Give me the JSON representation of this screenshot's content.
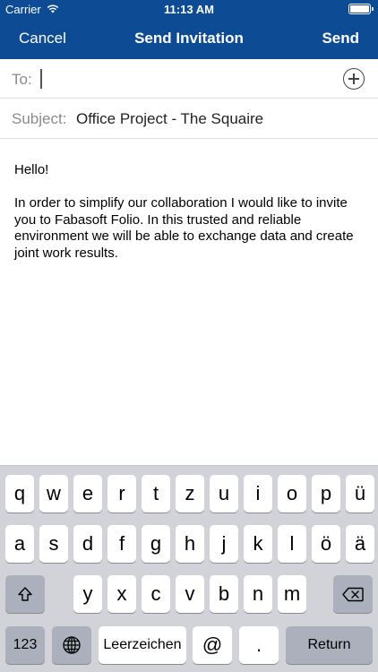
{
  "status": {
    "carrier": "Carrier",
    "time": "11:13 AM"
  },
  "nav": {
    "cancel": "Cancel",
    "title": "Send Invitation",
    "send": "Send"
  },
  "fields": {
    "to_label": "To:",
    "to_value": "",
    "subject_label": "Subject:",
    "subject_value": "Office Project - The Squaire"
  },
  "message": {
    "greeting": "Hello!",
    "text": "In order to simplify our collaboration I would like to invite you to Fabasoft Folio. In this trusted and reliable environment we will be able to exchange data and create joint work results."
  },
  "keyboard": {
    "row1": [
      "q",
      "w",
      "e",
      "r",
      "t",
      "z",
      "u",
      "i",
      "o",
      "p",
      "ü"
    ],
    "row2": [
      "a",
      "s",
      "d",
      "f",
      "g",
      "h",
      "j",
      "k",
      "l",
      "ö",
      "ä"
    ],
    "row3": [
      "y",
      "x",
      "c",
      "v",
      "b",
      "n",
      "m"
    ],
    "numbers": "123",
    "space": "Leerzeichen",
    "at": "@",
    "dot": ".",
    "return": "Return"
  }
}
